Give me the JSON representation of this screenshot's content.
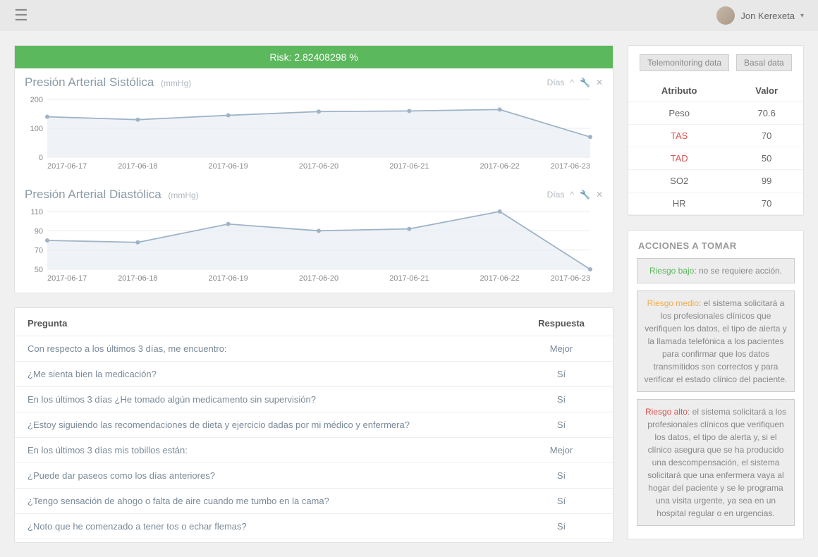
{
  "header": {
    "user_name": "Jon Kerexeta"
  },
  "risk": {
    "label": "Risk: 2.82408298 %"
  },
  "charts_days_label": "Días",
  "chart_data": [
    {
      "type": "line",
      "title": "Presión Arterial Sistólica",
      "unit": "(mmHg)",
      "categories": [
        "2017-06-17",
        "2017-06-18",
        "2017-06-19",
        "2017-06-20",
        "2017-06-21",
        "2017-06-22",
        "2017-06-23"
      ],
      "values": [
        140,
        130,
        145,
        158,
        160,
        165,
        70
      ],
      "ylim": [
        0,
        200
      ],
      "yticks": [
        0,
        100,
        200
      ]
    },
    {
      "type": "line",
      "title": "Presión Arterial Diastólica",
      "unit": "(mmHg)",
      "categories": [
        "2017-06-17",
        "2017-06-18",
        "2017-06-19",
        "2017-06-20",
        "2017-06-21",
        "2017-06-22",
        "2017-06-23"
      ],
      "values": [
        80,
        78,
        97,
        90,
        92,
        110,
        50
      ],
      "ylim": [
        50,
        110
      ],
      "yticks": [
        50,
        70,
        90,
        110
      ]
    }
  ],
  "questions": {
    "q_header": "Pregunta",
    "a_header": "Respuesta",
    "rows": [
      {
        "q": "Con respecto a los últimos 3 días, me encuentro:",
        "a": "Mejor"
      },
      {
        "q": "¿Me sienta bien la medicación?",
        "a": "Sí"
      },
      {
        "q": "En los últimos 3 días ¿He tomado algún medicamento sin supervisión?",
        "a": "Sí"
      },
      {
        "q": "¿Estoy siguiendo las recomendaciones de dieta y ejercicio dadas por mi médico y enfermera?",
        "a": "Sí"
      },
      {
        "q": "En los últimos 3 días mis tobillos están:",
        "a": "Mejor"
      },
      {
        "q": "¿Puede dar paseos como los días anteriores?",
        "a": "Sí"
      },
      {
        "q": "¿Tengo sensación de ahogo o falta de aire cuando me tumbo en la cama?",
        "a": "Sí"
      },
      {
        "q": "¿Noto que he comenzado a tener tos o echar flemas?",
        "a": "Sí"
      }
    ]
  },
  "side_tabs": {
    "telemonitoring": "Telemonitoring data",
    "basal": "Basal data"
  },
  "attr_table": {
    "attr_header": "Atributo",
    "val_header": "Valor",
    "rows": [
      {
        "attr": "Peso",
        "val": "70.6",
        "red": false
      },
      {
        "attr": "TAS",
        "val": "70",
        "red": true
      },
      {
        "attr": "TAD",
        "val": "50",
        "red": true
      },
      {
        "attr": "SO2",
        "val": "99",
        "red": false
      },
      {
        "attr": "HR",
        "val": "70",
        "red": false
      }
    ]
  },
  "actions": {
    "title": "ACCIONES A TOMAR",
    "low_label": "Riesgo bajo",
    "low_text": ": no se requiere acción.",
    "med_label": "Riesgo medio",
    "med_text": ": el sistema solicitará a los profesionales clínicos que verifiquen los datos, el tipo de alerta y la llamada telefónica a los pacientes para confirmar que los datos transmitidos son correctos y para verificar el estado clínico del paciente.",
    "high_label": "Riesgo alto",
    "high_text": ": el sistema solicitará a los profesionales clínicos que verifiquen los datos, el tipo de alerta y, si el clínico asegura que se ha producido una descompensación, el sistema solicitará que una enfermera vaya al hogar del paciente y se le programa una visita urgente, ya sea en un hospital regular o en urgencias."
  }
}
